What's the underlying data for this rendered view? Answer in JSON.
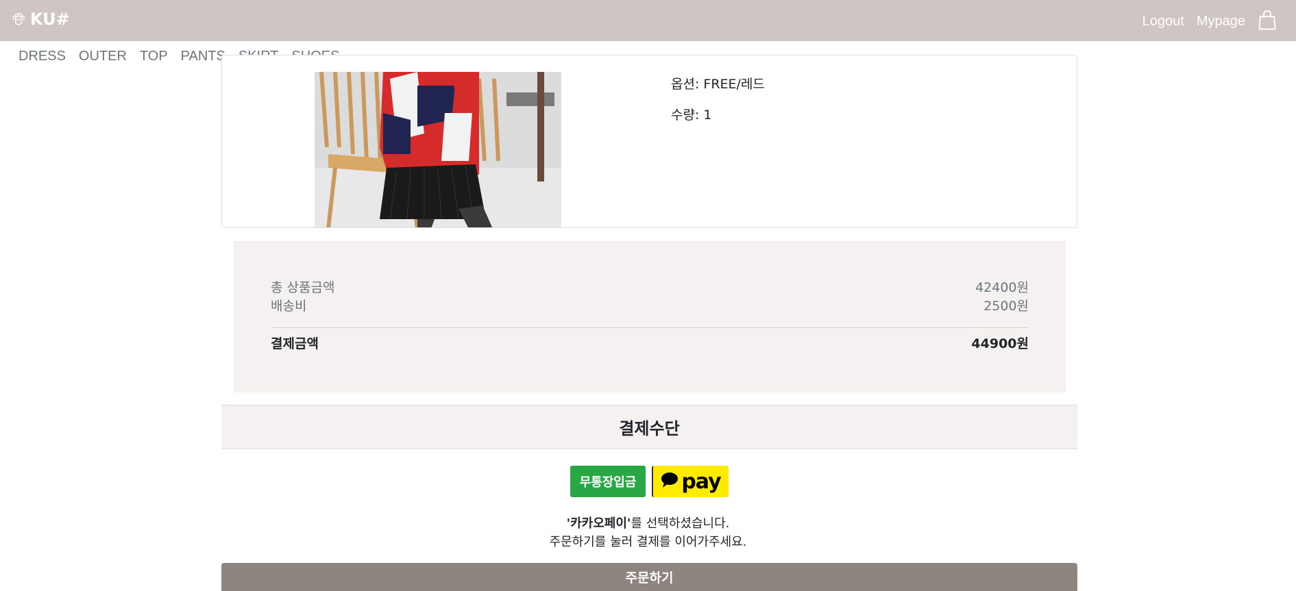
{
  "header": {
    "brand": "KU#",
    "logo_icon": "paw-icon",
    "logout_label": "Logout",
    "mypage_label": "Mypage",
    "cart_icon": "shopping-bag-icon"
  },
  "categories": [
    "DRESS",
    "OUTER",
    "TOP",
    "PANTS",
    "SKIRT",
    "SHOES"
  ],
  "product": {
    "option_text": "옵션: FREE/레드",
    "quantity_text": "수량: 1"
  },
  "summary": {
    "subtotal_label": "총 상품금액",
    "subtotal_value": "42400원",
    "shipping_label": "배송비",
    "shipping_value": "2500원",
    "total_label": "결제금액",
    "total_value": "44900원"
  },
  "payment": {
    "title": "결제수단",
    "bank_label": "무통장입금",
    "kakao_label": "pay",
    "selected_name": "'카카오페이'",
    "selected_suffix": "를 선택하셨습니다.",
    "instruction": "주문하기를 눌러 결제를 이어가주세요."
  },
  "order_button_label": "주문하기",
  "colors": {
    "topbar": "#cfc5c3",
    "summary_bg": "#f5f1f0",
    "bank_green": "#28a745",
    "kakao_yellow": "#ffeb00",
    "order_button": "#8f8580"
  }
}
